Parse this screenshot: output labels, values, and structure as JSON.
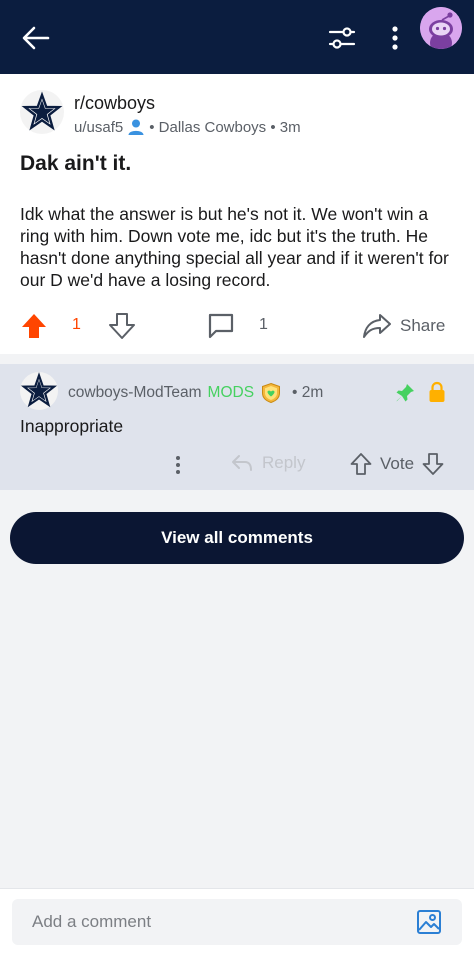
{
  "header": {
    "icons": [
      "back-arrow-icon",
      "filter-sliders-icon",
      "more-vertical-icon",
      "avatar"
    ]
  },
  "post": {
    "subreddit": "r/cowboys",
    "username": "u/usaf5",
    "flair": "• Dallas Cowboys • 3m",
    "title": "Dak ain't it.",
    "body": "Idk what the answer is but he's not it. We won't win a ring with him. Down vote me, idc but it's the truth. He hasn't done anything special all year and if it weren't for our D we'd have a losing record.",
    "score": "1",
    "comment_count": "1",
    "share_label": "Share"
  },
  "comment": {
    "author": "cowboys-ModTeam",
    "mods_label": "MODS",
    "time": "• 2m",
    "body": "Inappropriate",
    "reply_label": "Reply",
    "vote_label": "Vote"
  },
  "view_all_label": "View all comments",
  "composer": {
    "placeholder": "Add a comment"
  },
  "colors": {
    "header_bg": "#0b1d3f",
    "upvote_active": "#ff4500",
    "mods_green": "#46d160",
    "button_bg": "#0b1633",
    "comment_bg": "#dfe3ec"
  }
}
